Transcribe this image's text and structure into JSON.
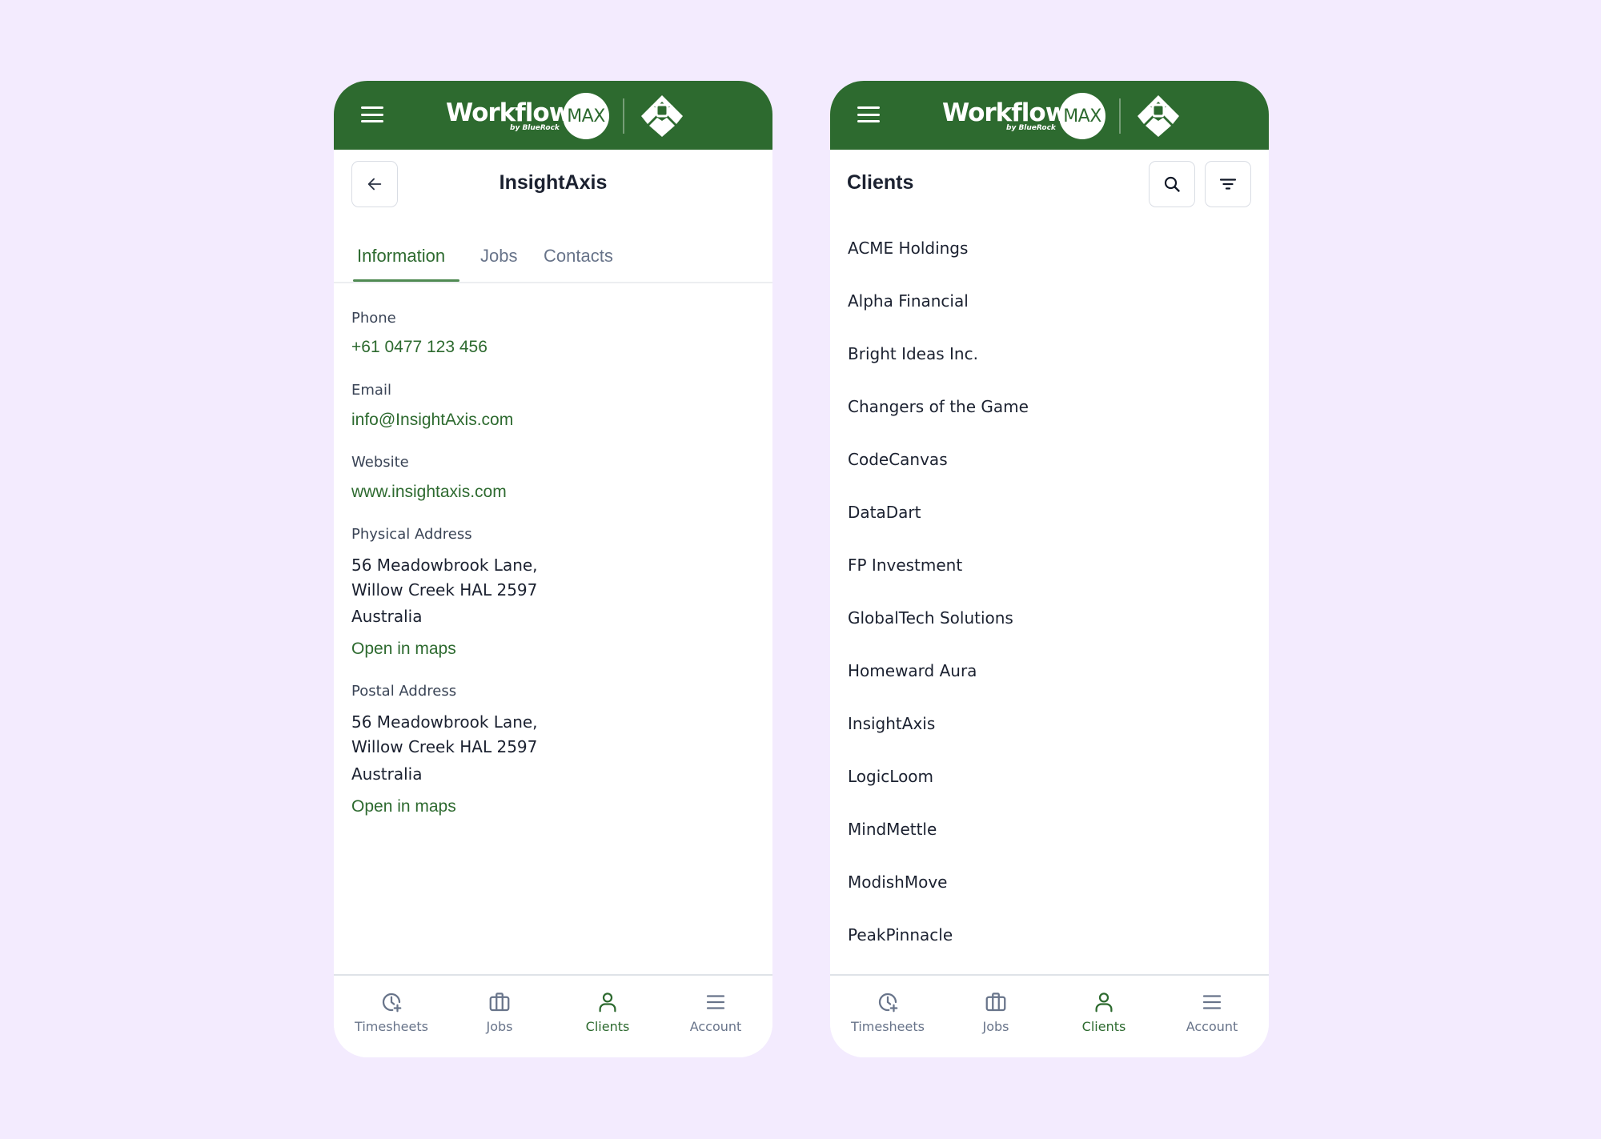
{
  "brand": {
    "name": "Workflow",
    "badge": "MAX",
    "tagline": "by BlueRock",
    "header_color": "#2d6a2f",
    "accent_color": "#2d6a2f",
    "background_color": "#f3ebfe"
  },
  "detail_screen": {
    "title": "InsightAxis",
    "back_icon": "arrow-left-icon",
    "menu_icon": "hamburger-icon",
    "tabs": [
      {
        "label": "Information",
        "active": true
      },
      {
        "label": "Jobs",
        "active": false
      },
      {
        "label": "Contacts",
        "active": false
      }
    ],
    "fields": {
      "phone": {
        "label": "Phone",
        "value": "+61 0477 123 456"
      },
      "email": {
        "label": "Email",
        "value": "info@InsightAxis.com"
      },
      "website": {
        "label": "Website",
        "value": "www.insightaxis.com"
      },
      "physical_address": {
        "label": "Physical Address",
        "lines": [
          "56 Meadowbrook Lane,",
          "Willow Creek HAL 2597",
          "Australia"
        ],
        "link": "Open in maps"
      },
      "postal_address": {
        "label": "Postal Address",
        "lines": [
          "56 Meadowbrook Lane,",
          "Willow Creek HAL 2597",
          "Australia"
        ],
        "link": "Open in maps"
      }
    }
  },
  "list_screen": {
    "title": "Clients",
    "search_icon": "search-icon",
    "filter_icon": "filter-icon",
    "clients": [
      "ACME Holdings",
      "Alpha Financial",
      "Bright Ideas Inc.",
      "Changers of the Game",
      "CodeCanvas",
      "DataDart",
      "FP Investment",
      "GlobalTech Solutions",
      "Homeward Aura",
      "InsightAxis",
      "LogicLoom",
      "MindMettle",
      "ModishMove",
      "PeakPinnacle"
    ]
  },
  "bottom_nav": [
    {
      "label": "Timesheets",
      "icon": "clock-plus-icon",
      "active": false
    },
    {
      "label": "Jobs",
      "icon": "briefcase-icon",
      "active": false
    },
    {
      "label": "Clients",
      "icon": "user-icon",
      "active": true
    },
    {
      "label": "Account",
      "icon": "menu-icon",
      "active": false
    }
  ]
}
